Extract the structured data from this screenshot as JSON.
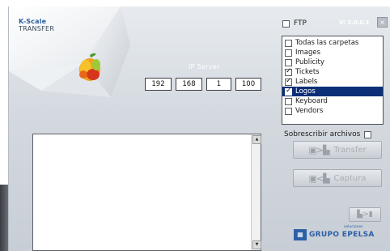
{
  "brand": {
    "line1": "K-Scale",
    "line2": "TRANSFER"
  },
  "version": "V: 2.0.0.1",
  "close_label": "×",
  "ftp": {
    "label": "FTP",
    "checked": false
  },
  "folders": [
    {
      "label": "Todas las carpetas",
      "checked": false,
      "selected": false
    },
    {
      "label": "Images",
      "checked": false,
      "selected": false
    },
    {
      "label": "Publicity",
      "checked": false,
      "selected": false
    },
    {
      "label": "Tickets",
      "checked": true,
      "selected": false
    },
    {
      "label": "Labels",
      "checked": true,
      "selected": false
    },
    {
      "label": "Logos",
      "checked": true,
      "selected": true
    },
    {
      "label": "Keyboard",
      "checked": false,
      "selected": false
    },
    {
      "label": "Vendors",
      "checked": false,
      "selected": false
    }
  ],
  "ip_server": {
    "label": "IP Server",
    "octets": [
      "192",
      "168",
      "1",
      "100"
    ]
  },
  "overwrite": {
    "label": "Sobrescribir archivos",
    "checked": false
  },
  "log": {
    "content": ""
  },
  "buttons": {
    "transfer": {
      "label": "Transfer",
      "icon": "pc-to-scale-icon"
    },
    "capture": {
      "label": "Captura",
      "icon": "scale-to-pc-icon"
    },
    "small": {
      "icon": "scale-export-icon"
    }
  },
  "company": {
    "name": "GRUPO EPELSA",
    "tagline": "soluciones"
  },
  "colors": {
    "selection": "#0c2f78",
    "brand_blue": "#2b5fa6",
    "window_bg": "#d3d9df"
  }
}
